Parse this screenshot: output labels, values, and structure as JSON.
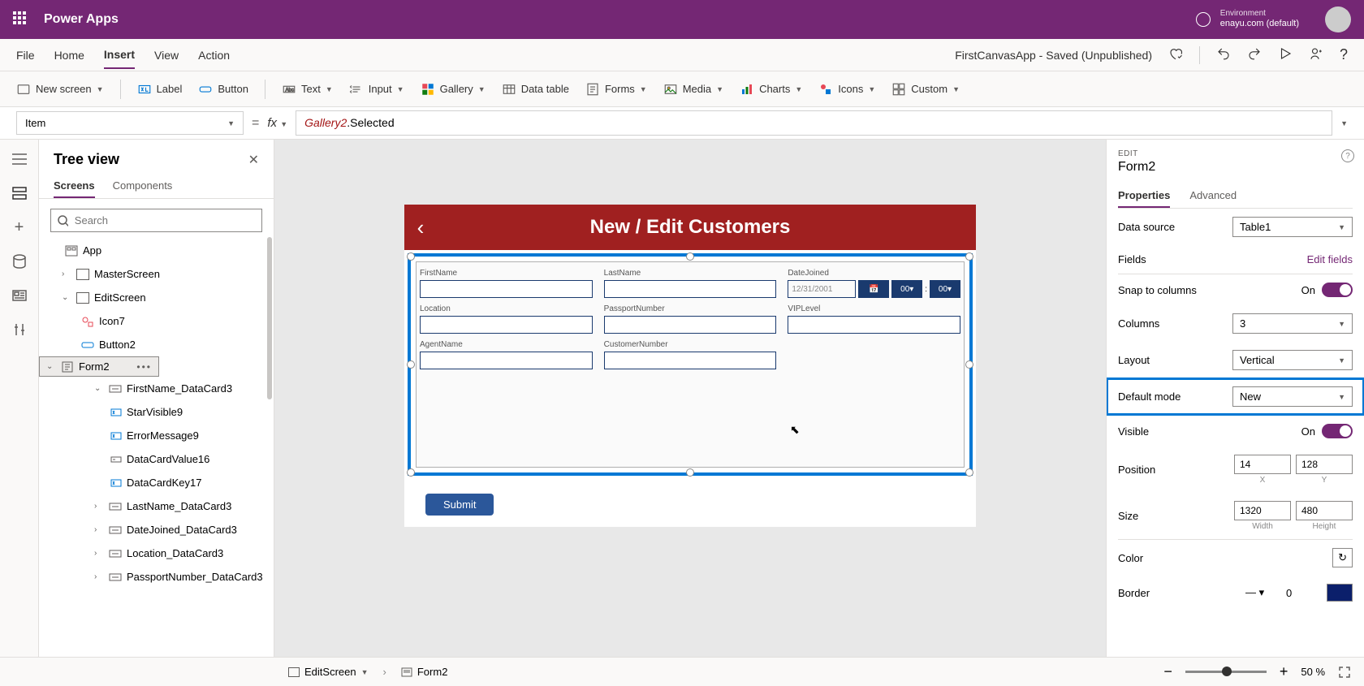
{
  "header": {
    "app_name": "Power Apps",
    "env_label": "Environment",
    "env_value": "enayu.com (default)"
  },
  "menu": {
    "items": [
      "File",
      "Home",
      "Insert",
      "View",
      "Action"
    ],
    "active": "Insert",
    "doc_title": "FirstCanvasApp - Saved (Unpublished)"
  },
  "ribbon": {
    "new_screen": "New screen",
    "label": "Label",
    "button": "Button",
    "text": "Text",
    "input": "Input",
    "gallery": "Gallery",
    "data_table": "Data table",
    "forms": "Forms",
    "media": "Media",
    "charts": "Charts",
    "icons": "Icons",
    "custom": "Custom"
  },
  "formula": {
    "property": "Item",
    "fx": "fx",
    "obj": "Gallery2",
    "rest": ".Selected"
  },
  "tree": {
    "title": "Tree view",
    "tabs": {
      "screens": "Screens",
      "components": "Components"
    },
    "search_ph": "Search",
    "items": {
      "app": "App",
      "master": "MasterScreen",
      "edit": "EditScreen",
      "icon7": "Icon7",
      "button2": "Button2",
      "form2": "Form2",
      "fn_dc": "FirstName_DataCard3",
      "star": "StarVisible9",
      "err": "ErrorMessage9",
      "dcv": "DataCardValue16",
      "dck": "DataCardKey17",
      "ln_dc": "LastName_DataCard3",
      "dj_dc": "DateJoined_DataCard3",
      "loc_dc": "Location_DataCard3",
      "pn_dc": "PassportNumber_DataCard3"
    }
  },
  "canvas": {
    "title": "New / Edit Customers",
    "fields": {
      "firstname": "FirstName",
      "lastname": "LastName",
      "datejoined": "DateJoined",
      "location": "Location",
      "passport": "PassportNumber",
      "vip": "VIPLevel",
      "agent": "AgentName",
      "custnum": "CustomerNumber"
    },
    "date_val": "12/31/2001",
    "hour": "00",
    "min": "00",
    "submit": "Submit"
  },
  "props": {
    "edit": "EDIT",
    "name": "Form2",
    "tabs": {
      "properties": "Properties",
      "advanced": "Advanced"
    },
    "data_source": "Data source",
    "data_source_val": "Table1",
    "fields": "Fields",
    "edit_fields": "Edit fields",
    "snap": "Snap to columns",
    "on": "On",
    "columns": "Columns",
    "columns_val": "3",
    "layout": "Layout",
    "layout_val": "Vertical",
    "default_mode": "Default mode",
    "default_mode_val": "New",
    "visible": "Visible",
    "position": "Position",
    "pos_x": "14",
    "pos_y": "128",
    "x_lbl": "X",
    "y_lbl": "Y",
    "size": "Size",
    "width": "1320",
    "height": "480",
    "w_lbl": "Width",
    "h_lbl": "Height",
    "color": "Color",
    "border": "Border",
    "border_val": "0"
  },
  "status": {
    "crumb1": "EditScreen",
    "crumb2": "Form2",
    "zoom": "50",
    "pct": "%"
  }
}
